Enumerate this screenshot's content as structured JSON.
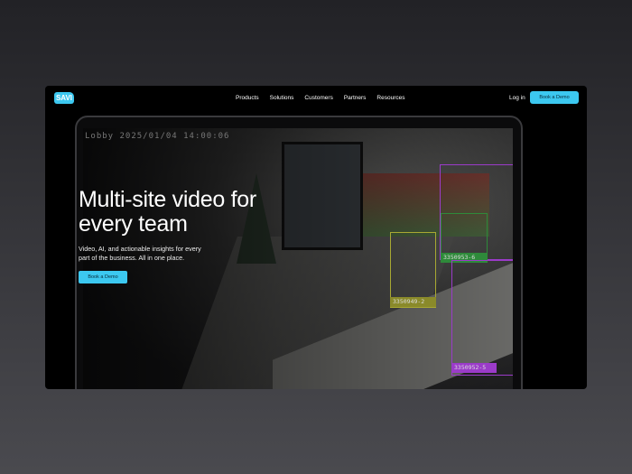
{
  "header": {
    "logo": "SAVI",
    "nav": [
      "Products",
      "Solutions",
      "Customers",
      "Partners",
      "Resources"
    ],
    "login": "Log in",
    "cta": "Book a Demo"
  },
  "hero": {
    "title": "Multi-site video for every team",
    "subtitle": "Video, AI, and actionable insights for every part of the business. All in one place.",
    "cta": "Book a Demo"
  },
  "video": {
    "timestamp": "Lobby 2025/01/04 14:00:06",
    "detections": [
      {
        "id": "3350953-6",
        "color": "#2e8a3a"
      },
      {
        "id": "3350949-2",
        "color": "#a8a832"
      },
      {
        "id": "3350952-5",
        "color": "#9b3bc9"
      }
    ]
  }
}
